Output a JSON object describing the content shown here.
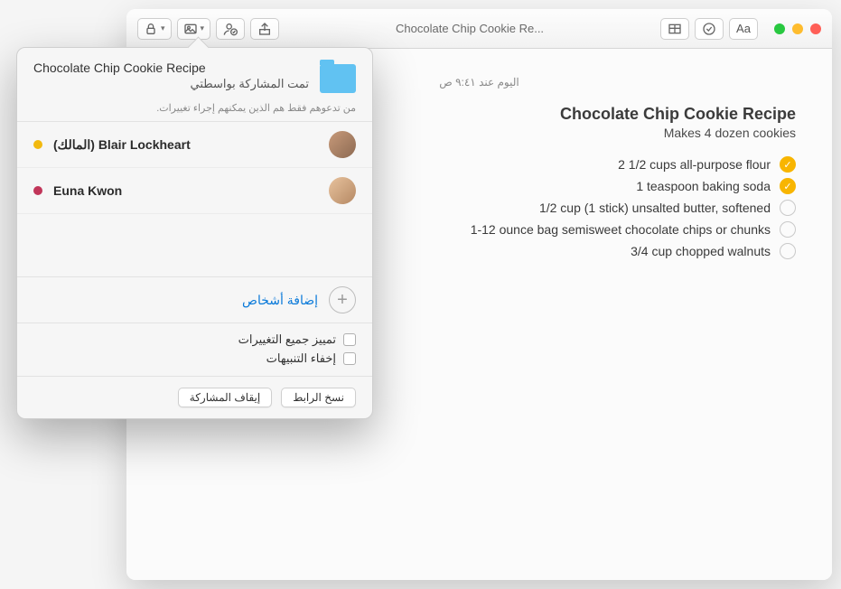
{
  "window": {
    "title": "Chocolate Chip Cookie Re..."
  },
  "toolbar": {
    "format_label": "Aa"
  },
  "note": {
    "date": "اليوم عند ٩:٤١ ص",
    "title": "Chocolate Chip Cookie Recipe",
    "subtitle": "Makes 4 dozen cookies",
    "items": [
      {
        "text": "2 1/2 cups all-purpose flour",
        "checked": true
      },
      {
        "text": "1 teaspoon baking soda",
        "checked": true
      },
      {
        "text": "1/2 cup (1 stick) unsalted butter, softened",
        "checked": false
      },
      {
        "text": "1-12 ounce bag semisweet chocolate chips or chunks",
        "checked": false
      },
      {
        "text": "3/4 cup chopped walnuts",
        "checked": false
      }
    ]
  },
  "share_popover": {
    "title": "Chocolate Chip Cookie Recipe",
    "shared_by": "تمت المشاركة بواسطتي",
    "hint": "من تدعوهم فقط هم الذين يمكنهم إجراء تغييرات.",
    "people": [
      {
        "name": "Blair Lockheart",
        "role": "(المالك)",
        "color": "#f2b90f"
      },
      {
        "name": "Euna Kwon",
        "role": "",
        "color": "#c13559"
      }
    ],
    "add_people_label": "إضافة أشخاص",
    "highlight_changes_label": "تمييز جميع التغييرات",
    "hide_alerts_label": "إخفاء التنبيهات",
    "copy_link_label": "نسخ الرابط",
    "stop_sharing_label": "إيقاف المشاركة"
  }
}
